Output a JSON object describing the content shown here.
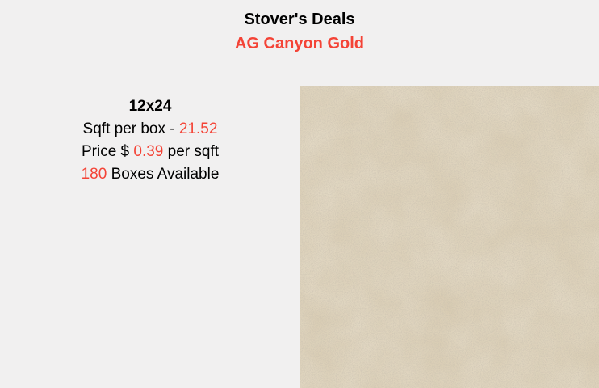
{
  "header": {
    "store_name": "Stover's Deals",
    "product_name": "AG Canyon Gold"
  },
  "product": {
    "size": "12x24",
    "sqft_label": "Sqft per box - ",
    "sqft_value": "21.52",
    "price_prefix": "Price $ ",
    "price_value": "0.39",
    "price_suffix": " per sqft",
    "boxes_value": "180",
    "boxes_suffix": " Boxes Available"
  },
  "colors": {
    "accent": "#f44336",
    "background": "#f1f0f0",
    "tile_base": "#d8cbb1"
  }
}
